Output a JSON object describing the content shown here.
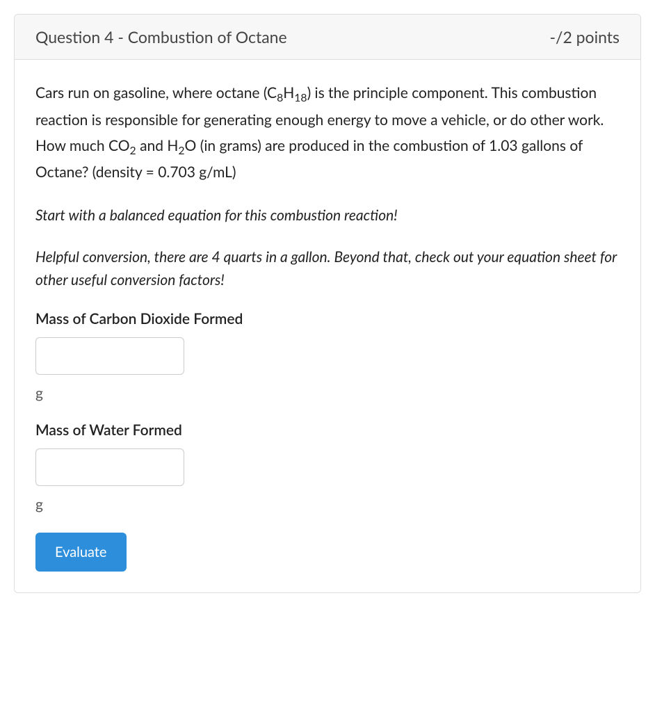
{
  "header": {
    "title": "Question 4 - Combustion of Octane",
    "points": "-/2 points"
  },
  "body": {
    "question_html": "Cars run on gasoline, where octane (C<sub>8</sub>H<sub>18</sub>) is the principle component.  This combustion reaction is responsible for generating enough energy to move a vehicle, or do other work.  How much CO<sub>2</sub> and H<sub>2</sub>O (in grams) are produced in the combustion of  1.03 gallons of Octane? (density = 0.703 g/mL)",
    "hint1": "Start with a balanced equation for this combustion reaction!",
    "hint2": "Helpful conversion, there are 4 quarts in a gallon.  Beyond that, check out your equation sheet for other useful conversion factors!",
    "field1": {
      "label": "Mass of Carbon Dioxide Formed",
      "value": "",
      "unit": "g"
    },
    "field2": {
      "label": "Mass of Water Formed",
      "value": "",
      "unit": "g"
    },
    "button": "Evaluate"
  }
}
